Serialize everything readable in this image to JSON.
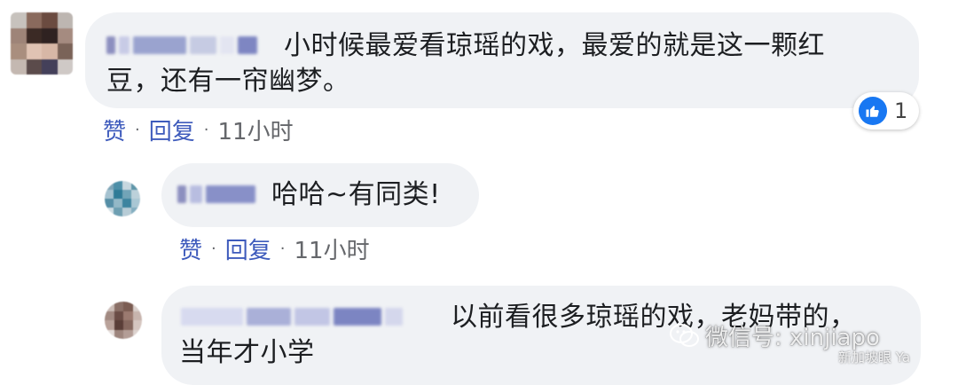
{
  "comments": [
    {
      "text_line1": "小时候最爱看琼瑶的戏，最爱的就是这一颗红",
      "text_line2": "豆，还有一帘幽梦。",
      "like_label": "赞",
      "reply_label": "回复",
      "time": "11小时",
      "reaction_icon": "like-thumb-icon",
      "reaction_count": "1"
    },
    {
      "text": "哈哈~有同类!",
      "like_label": "赞",
      "reply_label": "回复",
      "time": "11小时"
    },
    {
      "text_line1": "以前看很多琼瑶的戏，老妈带的，",
      "text_line2": "当年才小学"
    }
  ],
  "watermark": {
    "icon": "wechat-icon",
    "text": "微信号: xinjiapo",
    "sub": "新加坡眼 Ya"
  },
  "colors": {
    "bubble": "#f0f2f5",
    "link": "#3e5bbc",
    "like": "#1877f2"
  }
}
